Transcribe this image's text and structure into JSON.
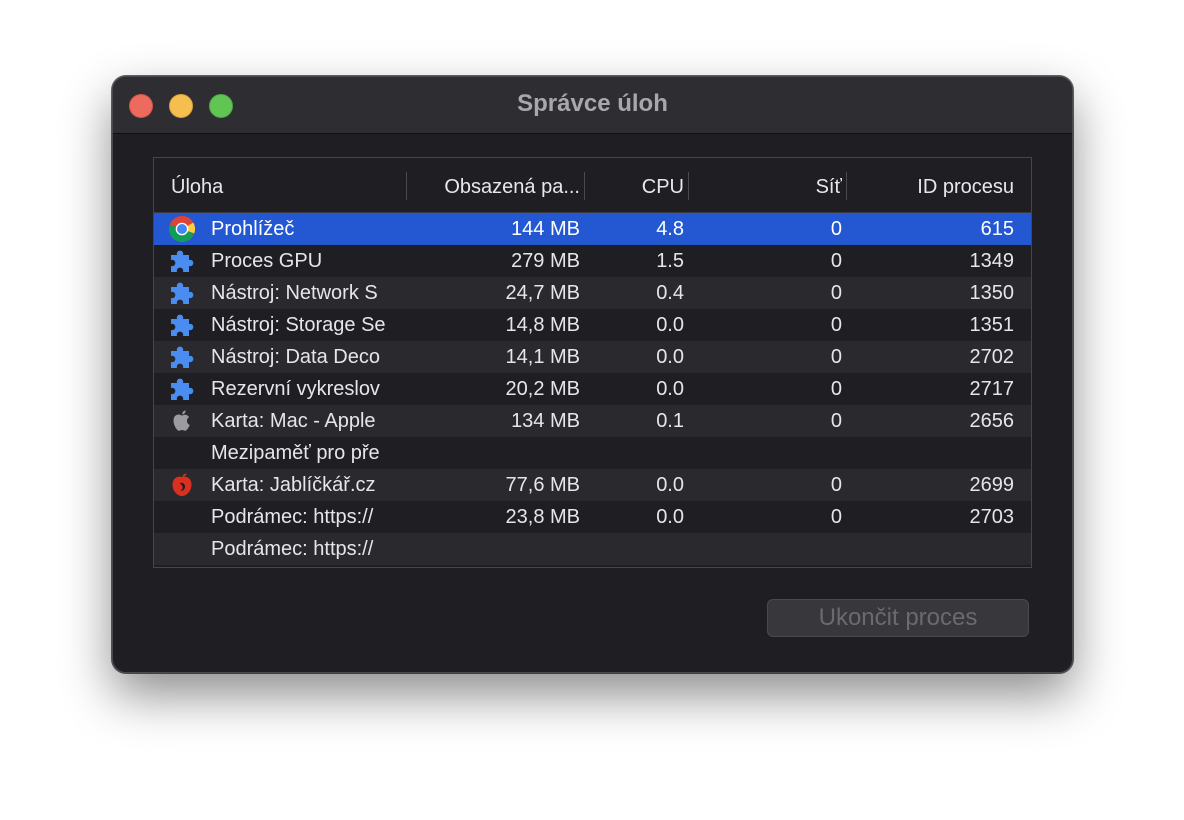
{
  "window": {
    "title": "Správce úloh"
  },
  "columns": {
    "task": "Úloha",
    "memory": "Obsazená pa...",
    "cpu": "CPU",
    "network": "Síť",
    "pid": "ID procesu"
  },
  "rows": [
    {
      "icon": "chrome-icon",
      "name": "Prohlížeč",
      "memory": "144 MB",
      "cpu": "4.8",
      "network": "0",
      "pid": "615",
      "selected": true
    },
    {
      "icon": "puzzle-icon",
      "name": "Proces GPU",
      "memory": "279 MB",
      "cpu": "1.5",
      "network": "0",
      "pid": "1349"
    },
    {
      "icon": "puzzle-icon",
      "name": "Nástroj: Network S",
      "memory": "24,7 MB",
      "cpu": "0.4",
      "network": "0",
      "pid": "1350"
    },
    {
      "icon": "puzzle-icon",
      "name": "Nástroj: Storage Se",
      "memory": "14,8 MB",
      "cpu": "0.0",
      "network": "0",
      "pid": "1351"
    },
    {
      "icon": "puzzle-icon",
      "name": "Nástroj: Data Deco",
      "memory": "14,1 MB",
      "cpu": "0.0",
      "network": "0",
      "pid": "2702"
    },
    {
      "icon": "puzzle-icon",
      "name": "Rezervní vykreslov",
      "memory": "20,2 MB",
      "cpu": "0.0",
      "network": "0",
      "pid": "2717"
    },
    {
      "icon": "apple-icon",
      "name": "Karta: Mac - Apple",
      "memory": "134 MB",
      "cpu": "0.1",
      "network": "0",
      "pid": "2656"
    },
    {
      "icon": "",
      "name": "Mezipaměť pro pře",
      "memory": "",
      "cpu": "",
      "network": "",
      "pid": ""
    },
    {
      "icon": "jablickar-icon",
      "name": "Karta: Jablíčkář.cz",
      "memory": "77,6 MB",
      "cpu": "0.0",
      "network": "0",
      "pid": "2699"
    },
    {
      "icon": "",
      "name": "Podrámec: https://",
      "memory": "23,8 MB",
      "cpu": "0.0",
      "network": "0",
      "pid": "2703"
    },
    {
      "icon": "",
      "name": "Podrámec: https://",
      "memory": "",
      "cpu": "",
      "network": "",
      "pid": ""
    }
  ],
  "end_button": {
    "label": "Ukončit proces",
    "enabled": false
  },
  "colors": {
    "selection": "#2358d2",
    "close": "#ed6a5e",
    "minimize": "#f5bf4f",
    "maximize": "#61c554",
    "puzzle": "#4a8df0"
  }
}
